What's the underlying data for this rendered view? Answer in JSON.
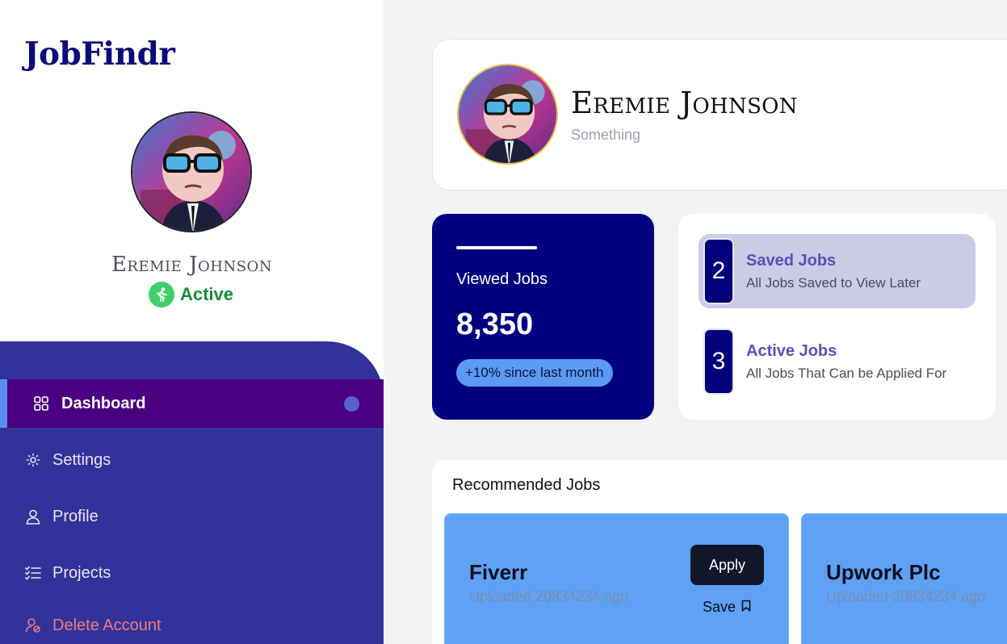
{
  "app": {
    "title": "JobFindr"
  },
  "user": {
    "name": "Eremie Johnson",
    "status": "Active",
    "subtitle": "Something"
  },
  "nav": {
    "items": [
      {
        "label": "Dashboard",
        "icon": "grid-icon",
        "active": true
      },
      {
        "label": "Settings",
        "icon": "gear-icon"
      },
      {
        "label": "Profile",
        "icon": "user-icon"
      },
      {
        "label": "Projects",
        "icon": "checklist-icon"
      },
      {
        "label": "Delete Account",
        "icon": "user-remove-icon"
      }
    ]
  },
  "stats": {
    "viewed": {
      "label": "Viewed Jobs",
      "value": "8,350",
      "badge": "+10% since last month"
    },
    "saved": {
      "count": "2",
      "title": "Saved Jobs",
      "description": "All Jobs Saved to View Later"
    },
    "active": {
      "count": "3",
      "title": "Active Jobs",
      "description": "All Jobs That Can be Applied For"
    }
  },
  "recommended": {
    "title": "Recommended Jobs",
    "jobs": [
      {
        "company": "Fiverr",
        "uploaded": "Uploaded 20834234 ago",
        "apply_label": "Apply",
        "save_label": "Save"
      },
      {
        "company": "Upwork Plc",
        "uploaded": "Uploaded 20834234 ago"
      }
    ]
  },
  "colors": {
    "brand": "#0b0b7a",
    "sidebar_nav": "#32339a",
    "nav_active": "#4b0082",
    "viewed_card": "#010080",
    "job_card": "#5ea1f5",
    "status_green": "#3fcf6b",
    "danger": "#f07a7a"
  }
}
